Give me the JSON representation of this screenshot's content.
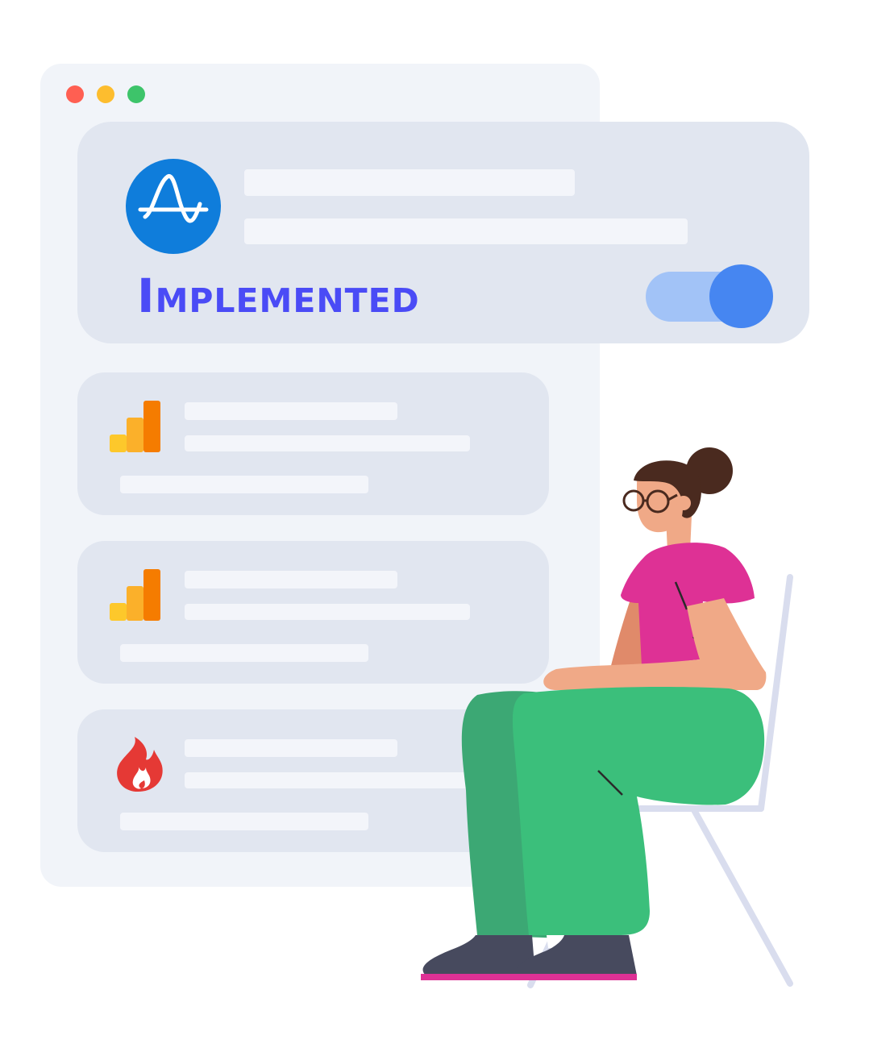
{
  "window": {
    "controls": [
      "close-dot",
      "minimize-dot",
      "maximize-dot"
    ],
    "control_colors": [
      "#ff5f52",
      "#fdbd2e",
      "#3dc46a"
    ]
  },
  "integrations": [
    {
      "name": "amplitude",
      "icon": "amplitude-logo-icon",
      "status": "Implemented",
      "enabled": true,
      "brand_color": "#0f7ddb"
    },
    {
      "name": "google-analytics-1",
      "icon": "google-analytics-icon",
      "brand_color": "#f57c00"
    },
    {
      "name": "google-analytics-2",
      "icon": "google-analytics-icon",
      "brand_color": "#f57c00"
    },
    {
      "name": "flame",
      "icon": "flame-icon",
      "brand_color": "#e53935"
    }
  ],
  "colors": {
    "accent_text": "#4a4bf6",
    "toggle_track": "#a2c3f7",
    "toggle_knob": "#4686f1",
    "card": "#e1e6f0",
    "window": "#f1f4f9"
  },
  "illustration": {
    "icon": "person-sitting-on-chair-icon",
    "shirt_color": "#de3195",
    "pants_color": "#3bbf7b"
  }
}
